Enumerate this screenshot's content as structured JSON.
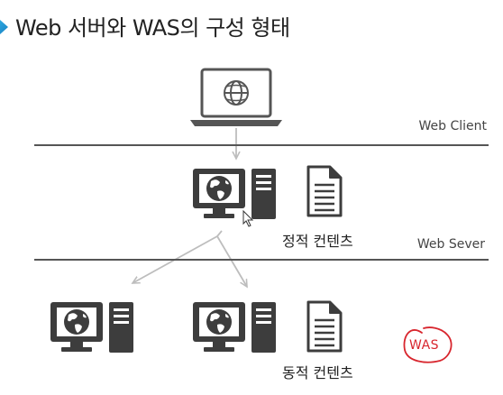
{
  "title": "Web 서버와 WAS의 구성 형태",
  "tiers": {
    "client": "Web Client",
    "server": "Web Sever"
  },
  "labels": {
    "static_content": "정적 컨텐츠",
    "dynamic_content": "동적 컨텐츠",
    "was_annotation": "WAS"
  },
  "colors": {
    "accent": "#1a8fd1",
    "annotation": "#d8262e",
    "icon_dark": "#3d3d3d",
    "arrow": "#bdbdbd"
  }
}
